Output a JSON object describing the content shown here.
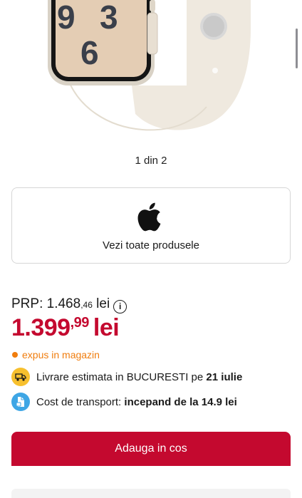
{
  "gallery": {
    "pager_text": "1 din 2"
  },
  "brand": {
    "icon": "apple-logo-icon",
    "link_label": "Vezi toate produsele"
  },
  "pricing": {
    "prp_label": "PRP:",
    "prp_int": "1.468",
    "prp_dec": ",46",
    "prp_currency": "lei",
    "price_int": "1.399",
    "price_dec": ",99",
    "price_currency": "lei"
  },
  "availability": {
    "text": "expus in magazin",
    "color": "#f07d0e"
  },
  "delivery": {
    "prefix": "Livrare estimata in BUCURESTI pe ",
    "date": "21 iulie",
    "icon": "delivery-truck-icon"
  },
  "transport": {
    "prefix": "Cost de transport: ",
    "value": "incepand de la 14.9 lei",
    "icon": "transport-cost-icon"
  },
  "cta": {
    "add_to_cart": "Adauga in cos"
  },
  "colors": {
    "accent": "#c4092f",
    "delivery_badge": "#f7c02e",
    "transport_badge": "#3ea6e5"
  }
}
